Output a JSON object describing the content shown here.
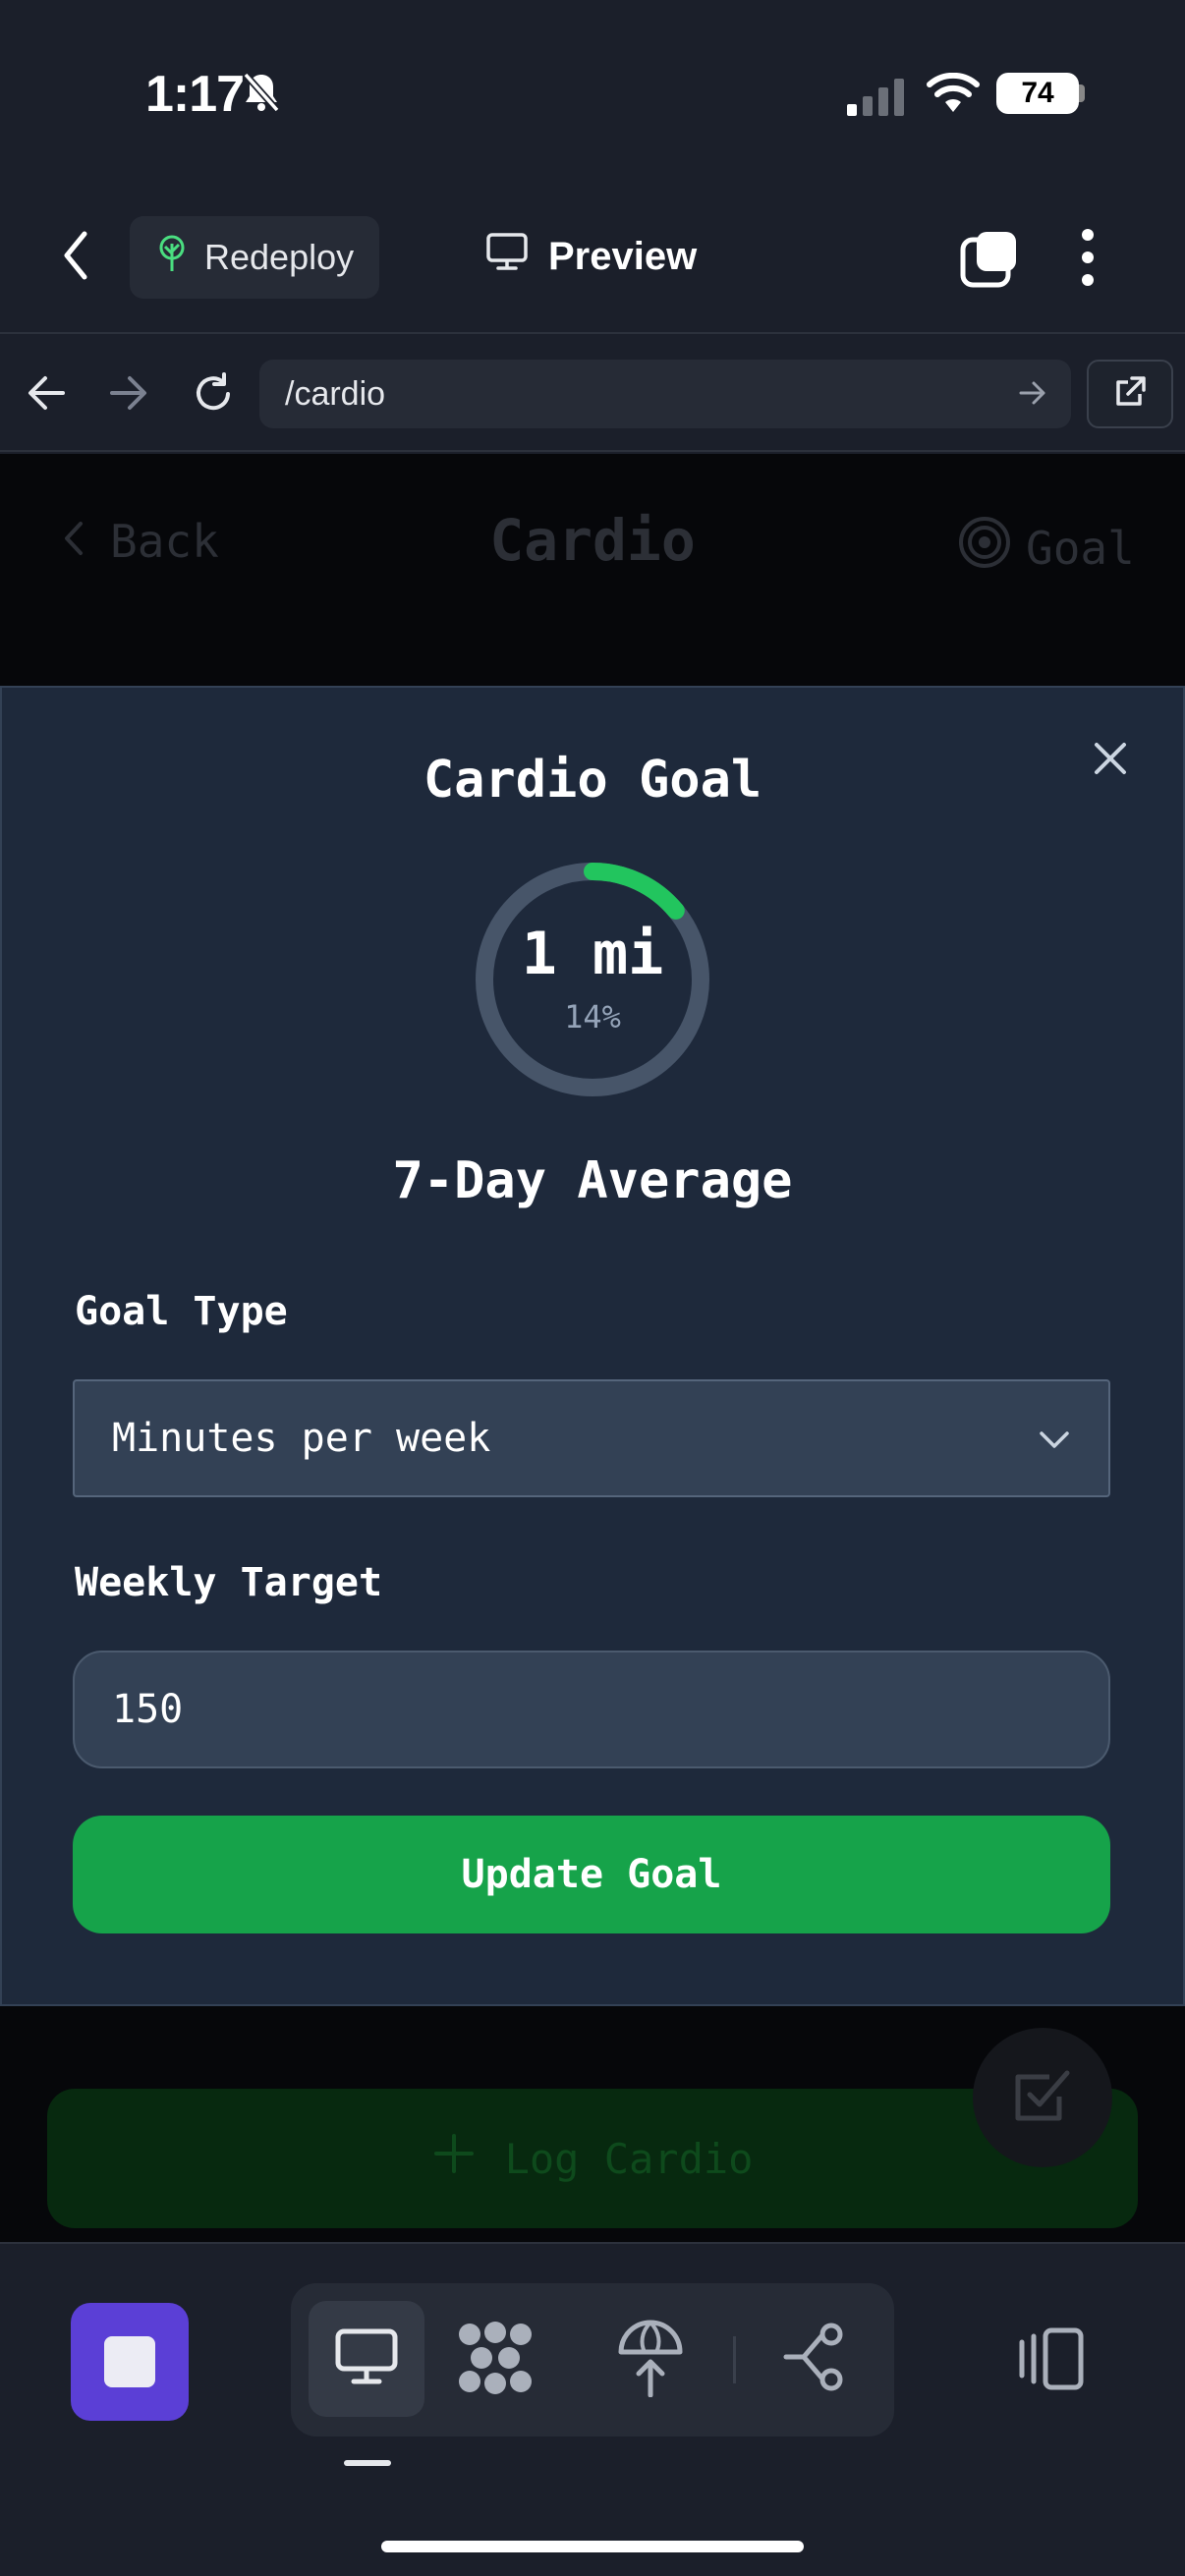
{
  "status_bar": {
    "time": "1:17",
    "battery": "74"
  },
  "header": {
    "redeploy_label": "Redeploy",
    "preview_label": "Preview"
  },
  "url_bar": {
    "url": "/cardio"
  },
  "page": {
    "back_label": "Back",
    "title": "Cardio",
    "goal_label": "Goal",
    "log_button_label": "Log Cardio"
  },
  "modal": {
    "title": "Cardio Goal",
    "progress": {
      "value": "1 mi",
      "percent_text": "14%",
      "percent": 0.14
    },
    "average_label": "7-Day Average",
    "goal_type": {
      "label": "Goal Type",
      "selected": "Minutes per week"
    },
    "weekly_target": {
      "label": "Weekly Target",
      "value": "150"
    },
    "submit_label": "Update Goal"
  },
  "colors": {
    "accent_green": "#16a34a",
    "ring_green": "#22c55e",
    "modal_bg": "#1e293b",
    "field_bg": "#334155",
    "stop_purple": "#5b3fd6"
  },
  "icons": [
    "bell-slash-icon",
    "signal-icon",
    "wifi-icon",
    "chevron-left-icon",
    "tree-icon",
    "monitor-icon",
    "tabs-icon",
    "more-vertical-icon",
    "arrow-left-icon",
    "arrow-right-icon",
    "reload-icon",
    "external-link-icon",
    "target-icon",
    "close-icon",
    "chevron-down-icon",
    "plus-icon",
    "checkbox-icon",
    "stop-icon",
    "nodes-icon",
    "deploy-icon",
    "graph-icon",
    "panel-icon"
  ]
}
